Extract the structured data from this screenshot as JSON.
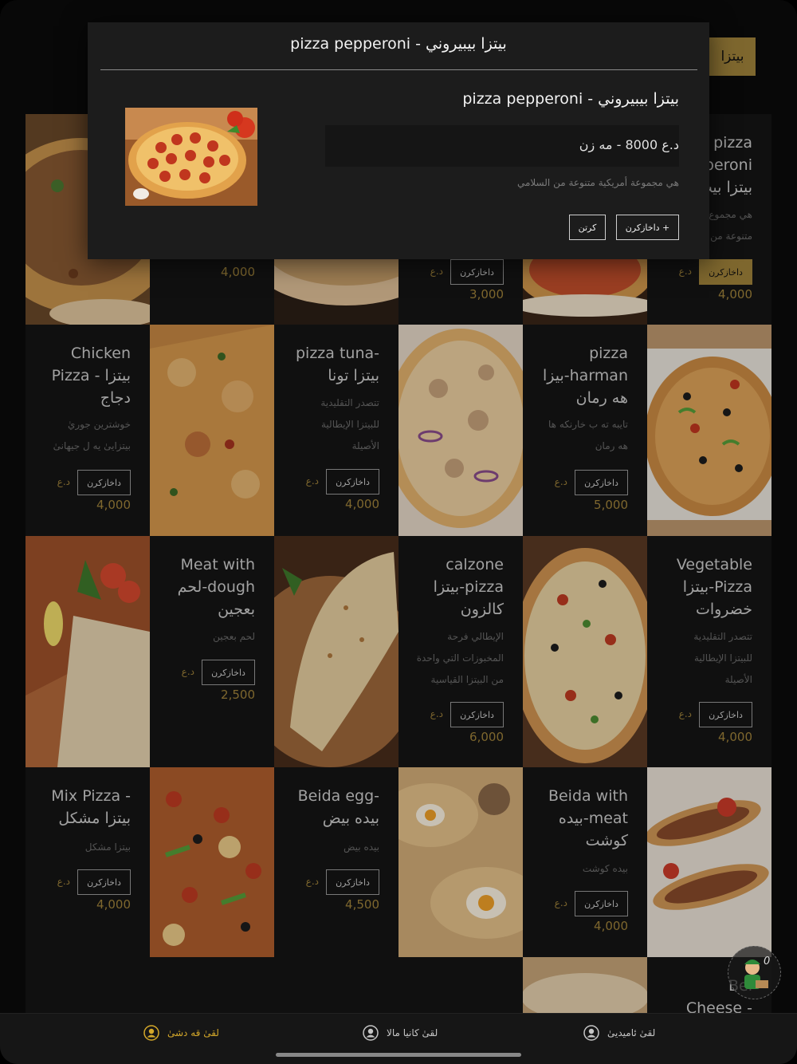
{
  "category": {
    "label": "بيتزا"
  },
  "modal": {
    "title": "pizza pepperoni - بيتزا بيبيروني",
    "item_name": "pizza pepperoni - بيتزا بيبيروني",
    "price": "د.ع 8000 - مه زن",
    "description": "هي مجموعة أمريكية متنوعة من السلامي",
    "add_label": "داخازكرن +",
    "close_label": "كرتن"
  },
  "row1": {
    "col1_name": "pizza\nperoni\nبيتزا بيب",
    "col1_desc": "هي مجموع\nمتنوعة من",
    "col1_button": "داخازكرن",
    "col1_currency": "د.ع",
    "col1_price": "4,000",
    "col3_button": "داخازكرن",
    "col3_currency": "د.ع",
    "col3_price": "3,000",
    "col5_price": "4,000"
  },
  "row2": [
    {
      "name": "pizza\nبيزا-harman\nهه رمان",
      "desc": "تايبه ته ب خارنكه ها\nهه رمان",
      "button": "داخازكرن",
      "currency": "د.ع",
      "price": "5,000"
    },
    {
      "name": "pizza tuna-\nبيتزا تونا",
      "desc": "تتصدر التقليدية\nللبيتزا الإيطالية\nالأصيلة",
      "button": "داخازكرن",
      "currency": "د.ع",
      "price": "4,000"
    },
    {
      "name": "Chicken\nPizza - بيتزا\nدجاج",
      "desc": "خوشترين جوريٰ\nبيتزايىٰ يه ل جيهانىٰ",
      "button": "داخازكرن",
      "currency": "د.ع",
      "price": "4,000"
    }
  ],
  "row3": [
    {
      "name": "Vegetable\nبيتزا-Pizza\nخضروات",
      "desc": "تتصدر التقليدية\nللبيتزا الإيطالية\nالأصيلة",
      "button": "داخازكرن",
      "currency": "د.ع",
      "price": "4,000"
    },
    {
      "name": "calzone\nبيتزا-pizza\nكالزون",
      "desc": "الإيطالي فرحة\nالمخبوزات التي واحدة\nمن البيتزا القياسية",
      "button": "داخازكرن",
      "currency": "د.ع",
      "price": "6,000"
    },
    {
      "name": "Meat with\nلحم-dough\nبعجين",
      "desc": "لحم بعجين",
      "button": "داخازكرن",
      "currency": "د.ع",
      "price": "2,500"
    }
  ],
  "row4": [
    {
      "name": "Beida with\nبيده-meat\nكوشت",
      "desc": "بيده كوشت",
      "button": "داخازكرن",
      "currency": "د.ع",
      "price": "4,000"
    },
    {
      "name": "Beida egg-\nبيده بيض",
      "desc": "بيده بيض",
      "button": "داخازكرن",
      "currency": "د.ع",
      "price": "4,500"
    },
    {
      "name": "Mix Pizza -\nبيتزا مشكل",
      "desc": "بيتزا مشكل",
      "button": "داخازكرن",
      "currency": "د.ع",
      "price": "4,000"
    }
  ],
  "row5": {
    "name": "Bei\nCheese -"
  },
  "cart": {
    "count": "0"
  },
  "tabbar": {
    "tab1": "لقىٰ ئاميديىٰ",
    "tab2": "لقىٰ كانيا مالا",
    "tab3": "لقىٰ قه دشىٰ"
  },
  "colors": {
    "accent": "#a2843b",
    "active_tab": "#d4a82a",
    "background": "#0b0b0b"
  }
}
